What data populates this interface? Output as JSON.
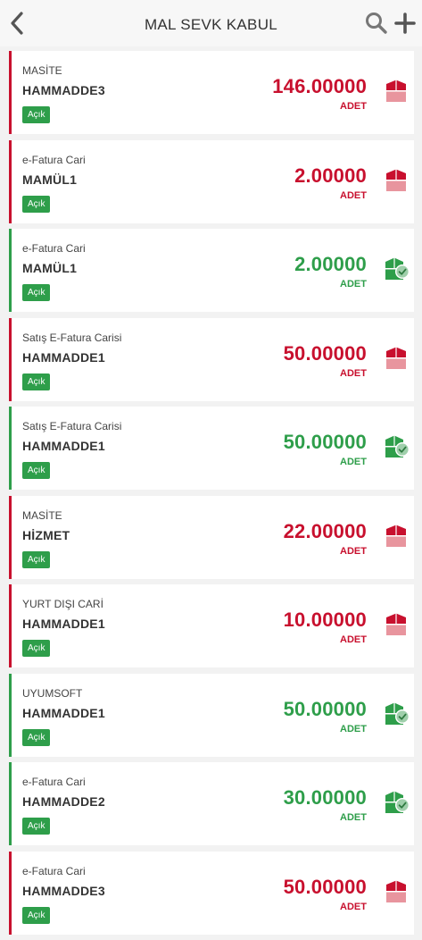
{
  "header": {
    "title": "MAL SEVK KABUL",
    "back_icon": "chevron-left-icon",
    "search_icon": "search-icon",
    "add_icon": "plus-icon"
  },
  "colors": {
    "open_status": "#c8102e",
    "completed_status": "#2e9e4a",
    "badge": "#2e9e4a"
  },
  "items": [
    {
      "customer": "MASİTE",
      "product": "HAMMADDE3",
      "status": "Açık",
      "quantity": "146.00000",
      "unit": "ADET",
      "state": "pending",
      "icon": "box-icon"
    },
    {
      "customer": "e-Fatura Cari",
      "product": "MAMÜL1",
      "status": "Açık",
      "quantity": "2.00000",
      "unit": "ADET",
      "state": "pending",
      "icon": "box-icon"
    },
    {
      "customer": "e-Fatura Cari",
      "product": "MAMÜL1",
      "status": "Açık",
      "quantity": "2.00000",
      "unit": "ADET",
      "state": "accepted",
      "icon": "box-check-icon"
    },
    {
      "customer": "Satış E-Fatura Carisi",
      "product": "HAMMADDE1",
      "status": "Açık",
      "quantity": "50.00000",
      "unit": "ADET",
      "state": "pending",
      "icon": "box-icon"
    },
    {
      "customer": "Satış E-Fatura Carisi",
      "product": "HAMMADDE1",
      "status": "Açık",
      "quantity": "50.00000",
      "unit": "ADET",
      "state": "accepted",
      "icon": "box-check-icon"
    },
    {
      "customer": "MASİTE",
      "product": "HİZMET",
      "status": "Açık",
      "quantity": "22.00000",
      "unit": "ADET",
      "state": "pending",
      "icon": "box-icon"
    },
    {
      "customer": "YURT DIŞI CARİ",
      "product": "HAMMADDE1",
      "status": "Açık",
      "quantity": "10.00000",
      "unit": "ADET",
      "state": "pending",
      "icon": "box-icon"
    },
    {
      "customer": "UYUMSOFT",
      "product": "HAMMADDE1",
      "status": "Açık",
      "quantity": "50.00000",
      "unit": "ADET",
      "state": "accepted",
      "icon": "box-check-icon"
    },
    {
      "customer": "e-Fatura Cari",
      "product": "HAMMADDE2",
      "status": "Açık",
      "quantity": "30.00000",
      "unit": "ADET",
      "state": "accepted",
      "icon": "box-check-icon"
    },
    {
      "customer": "e-Fatura Cari",
      "product": "HAMMADDE3",
      "status": "Açık",
      "quantity": "50.00000",
      "unit": "ADET",
      "state": "pending",
      "icon": "box-icon"
    }
  ]
}
